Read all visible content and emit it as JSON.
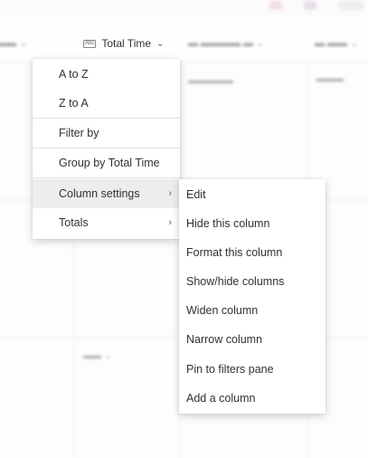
{
  "column_header": {
    "icon": "text-column-icon",
    "abc": "Abc",
    "label": "Total Time",
    "chevron": "⌄"
  },
  "column_menu": {
    "items": [
      {
        "label": "A to Z"
      },
      {
        "label": "Z to A"
      },
      {
        "label": "Filter by"
      },
      {
        "label": "Group by Total Time"
      },
      {
        "label": "Column settings",
        "submenu_arrow": "›"
      },
      {
        "label": "Totals",
        "submenu_arrow": "›"
      }
    ]
  },
  "column_settings_submenu": {
    "items": [
      {
        "label": "Edit"
      },
      {
        "label": "Hide this column"
      },
      {
        "label": "Format this column"
      },
      {
        "label": "Show/hide columns"
      },
      {
        "label": "Widen column"
      },
      {
        "label": "Narrow column"
      },
      {
        "label": "Pin to filters pane"
      },
      {
        "label": "Add a column"
      }
    ]
  },
  "colors": {
    "hover_background": "#ededed",
    "text": "#323130",
    "separator": "#e1dfdd"
  }
}
